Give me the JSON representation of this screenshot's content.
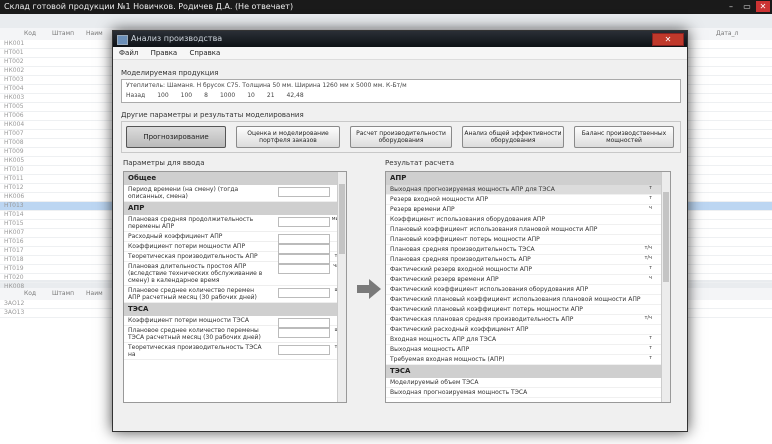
{
  "app": {
    "title": "Склад готовой продукции №1 Новичков. Родичев Д.А. (Не отвечает)",
    "win_min": "–",
    "win_max": "▭",
    "win_close": "✕"
  },
  "background": {
    "headers": [
      "Код",
      "Штамп",
      "Наим"
    ],
    "rows": [
      "НК001",
      "НТ001",
      "НТ002",
      "НК002",
      "НТ003",
      "НТ004",
      "НК003",
      "НТ005",
      "НТ006",
      "НК004",
      "НТ007",
      "НТ008",
      "НТ009",
      "НК005",
      "НТ010",
      "НТ011",
      "НТ012",
      "НК006",
      "НТ013",
      "НТ014",
      "НТ015",
      "НК007",
      "НТ016",
      "НТ017",
      "НТ018",
      "НТ019",
      "НТ020",
      "НК008"
    ],
    "right_header": "Дата_л",
    "headers2": [
      "Код",
      "Штамп",
      "Наим"
    ],
    "rows2": [
      "ЗАО12",
      "ЗАО13"
    ]
  },
  "dialog": {
    "title": "Анализ производства",
    "close": "✕",
    "menu": [
      "Файл",
      "Правка",
      "Справка"
    ],
    "model_label": "Моделируемая продукция",
    "model_line1": "Утеплитель: Шаманя. Н брусок С75. Толщина 50 мм. Ширина 1260 мм х 5000 мм. К-Бт/м",
    "model_values": [
      "Назад",
      "100",
      "100",
      "8",
      "1000",
      "10",
      "21",
      "42,48"
    ],
    "other_label": "Другие параметры и результаты моделирования",
    "buttons": [
      "Прогнозирование",
      "Оценка и моделирование портфеля заказов",
      "Расчет производительности оборудования",
      "Анализ общей эффективности оборудования",
      "Баланс производственных мощностей"
    ],
    "left_label": "Параметры для ввода",
    "right_label": "Результат расчета",
    "left_sections": [
      {
        "title": "Общее",
        "items": [
          {
            "label": "Период времени (на смену) (тогда описанных, смена)",
            "unit": ""
          }
        ]
      },
      {
        "title": "АПР",
        "items": [
          {
            "label": "Плановая средняя продолжительность перемены АПР",
            "unit": "мин"
          },
          {
            "label": "Расходный коэффициент АПР",
            "unit": ""
          },
          {
            "label": "Коэффициент потери мощности АПР",
            "unit": ""
          },
          {
            "label": "Теоретическая производительность АПР",
            "unit": "т/ч"
          },
          {
            "label": "Плановая длительность простоя АПР (вследствие технических обслуживание в смену) в календарное время",
            "unit": "час"
          },
          {
            "label": "Плановое среднее количество перемен АПР расчетный месяц (30 рабочих дней)",
            "unit": "шт"
          }
        ]
      },
      {
        "title": "ТЭСА",
        "items": [
          {
            "label": "Коэффициент потери мощности ТЭСА",
            "unit": ""
          },
          {
            "label": "Плановое среднее количество перемены ТЭСА расчетный месяц (30 рабочих дней)",
            "unit": "шт"
          },
          {
            "label": "Теоретическая производительность ТЭСА на",
            "unit": "т/ч"
          }
        ]
      }
    ],
    "right_sections": [
      {
        "title": "АПР",
        "items": [
          {
            "label": "Выходная прогнозируемая мощность АПР для ТЭСА",
            "unit": "т"
          },
          {
            "label": "Резерв входной мощности АПР",
            "unit": "т"
          },
          {
            "label": "Резерв времени АПР",
            "unit": "ч"
          },
          {
            "label": "Коэффициент использования оборудования АПР",
            "unit": ""
          },
          {
            "label": "Плановый коэффициент использования плановой мощности АПР",
            "unit": ""
          },
          {
            "label": "Плановый коэффициент потерь мощности АПР",
            "unit": ""
          },
          {
            "label": "Плановая средняя производительность ТЭСА",
            "unit": "т/ч"
          },
          {
            "label": "Плановая средняя производительность АПР",
            "unit": "т/ч"
          },
          {
            "label": "Фактический резерв входной мощности АПР",
            "unit": "т"
          },
          {
            "label": "Фактический резерв времени АПР",
            "unit": "ч"
          },
          {
            "label": "Фактический коэффициент использования оборудования АПР",
            "unit": ""
          },
          {
            "label": "Фактический плановый коэффициент использования плановой мощности АПР",
            "unit": ""
          },
          {
            "label": "Фактический плановый коэффициент потерь мощности АПР",
            "unit": ""
          },
          {
            "label": "Фактическая плановая средняя производительность АПР",
            "unit": "т/ч"
          },
          {
            "label": "Фактический расходный коэффициент АПР",
            "unit": ""
          },
          {
            "label": "Входная мощность АПР для ТЭСА",
            "unit": "т"
          },
          {
            "label": "Выходная мощность АПР",
            "unit": "т"
          },
          {
            "label": "Требуемая входная мощность (АПР)",
            "unit": "т"
          }
        ]
      },
      {
        "title": "ТЭСА",
        "items": [
          {
            "label": "Моделируемый объем ТЭСА",
            "unit": ""
          },
          {
            "label": "Выходная прогнозируемая мощность ТЭСА",
            "unit": ""
          }
        ]
      }
    ]
  }
}
